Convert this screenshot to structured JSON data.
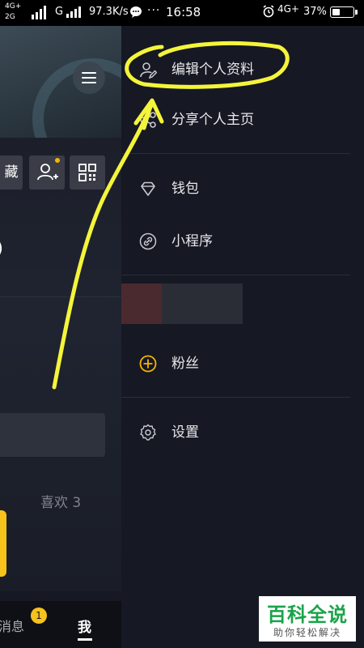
{
  "status_bar": {
    "network_left_top": "4G+",
    "network_left_bottom": "2G",
    "carrier_g": "G",
    "speed": "97.3K/s",
    "dots": "···",
    "time": "16:58",
    "network_right": "4G+",
    "battery_percent": "37%",
    "battery_level": 0.37
  },
  "profile": {
    "favorites_partial": "藏",
    "partial_char": ")",
    "likes_tab": "喜欢 3",
    "tabbar": {
      "messages": "消息",
      "messages_badge": "1",
      "me": "我"
    }
  },
  "drawer": {
    "items": [
      {
        "label": "编辑个人资料",
        "icon": "edit-profile-icon"
      },
      {
        "label": "分享个人主页",
        "icon": "share-icon"
      },
      {
        "label": "钱包",
        "icon": "wallet-diamond-icon"
      },
      {
        "label": "小程序",
        "icon": "mini-program-link-icon"
      },
      {
        "label": "粉丝",
        "icon": "fans-plus-icon"
      },
      {
        "label": "设置",
        "icon": "settings-gear-icon"
      }
    ]
  },
  "colors": {
    "background": "#161823",
    "accent_yellow": "#f7c21c",
    "annotation": "#f4f53a",
    "watermark_green": "#1aa34a"
  },
  "watermark": {
    "title": "百科全说",
    "subtitle": "助你轻松解决"
  }
}
